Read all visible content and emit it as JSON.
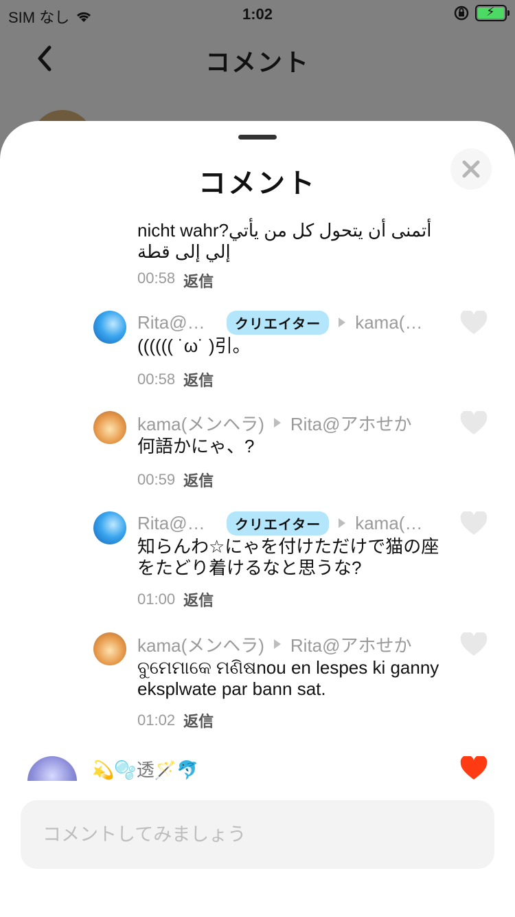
{
  "status_bar": {
    "carrier": "SIM なし",
    "time": "1:02"
  },
  "nav": {
    "title": "コメント"
  },
  "sheet": {
    "title": "コメント"
  },
  "orphan": {
    "text": "nicht wahr?أتمنى أن يتحول كل من يأتي إلي إلى قطة",
    "time": "00:58",
    "reply_label": "返信"
  },
  "replies": [
    {
      "user": "Rita@…",
      "badge": "クリエイター",
      "target": "kama(…",
      "text": "(((((( ˙ω˙ )引。",
      "time": "00:58",
      "reply_label": "返信"
    },
    {
      "user": "kama(メンヘラ)",
      "target": "Rita@アホせか",
      "text": "何語かにゃ、?",
      "time": "00:59",
      "reply_label": "返信"
    },
    {
      "user": "Rita@…",
      "badge": "クリエイター",
      "target": "kama(…",
      "text": "知らんわ☆にゃを付けただけで猫の座をたどり着けるなと思うな?",
      "time": "01:00",
      "reply_label": "返信"
    },
    {
      "user": "kama(メンヘラ)",
      "target": "Rita@アホせか",
      "text": "ବୁମେମାକେ ମଣିଷnou en lespes ki ganny eksplwate par bann sat.",
      "time": "01:02",
      "reply_label": "返信"
    }
  ],
  "bottom_comment": {
    "name": "💫🫧透🪄🐬"
  },
  "input": {
    "placeholder": "コメントしてみましょう"
  },
  "colors": {
    "badge": "#b3e5fb",
    "liked": "#ff3b14",
    "unliked": "#e8e8e8"
  }
}
